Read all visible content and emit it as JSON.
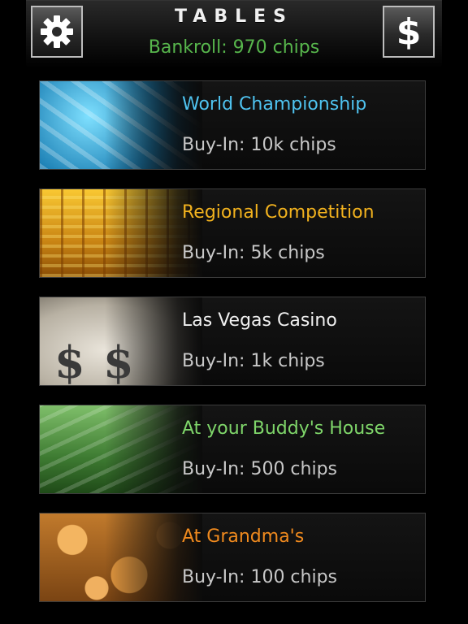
{
  "header": {
    "title": "TABLES",
    "bankroll": "Bankroll: 970 chips",
    "settings_icon": "gear-icon",
    "cash_icon": "dollar-icon",
    "cash_symbol": "$"
  },
  "tables": [
    {
      "name": "World Championship",
      "buyin": "Buy-In: 10k chips",
      "color": "#4fc3f0",
      "thumb": "ice-crystals"
    },
    {
      "name": "Regional Competition",
      "buyin": "Buy-In: 5k chips",
      "color": "#f2b21e",
      "thumb": "gold-coin-stacks"
    },
    {
      "name": "Las Vegas Casino",
      "buyin": "Buy-In: 1k chips",
      "color": "#f0f0f0",
      "thumb": "money-bags",
      "thumb_symbols": [
        "$",
        "$"
      ]
    },
    {
      "name": "At your Buddy's House",
      "buyin": "Buy-In: 500 chips",
      "color": "#7fd66a",
      "thumb": "dollar-bills"
    },
    {
      "name": "At Grandma's",
      "buyin": "Buy-In: 100 chips",
      "color": "#f08a1e",
      "thumb": "copper-coins"
    }
  ]
}
